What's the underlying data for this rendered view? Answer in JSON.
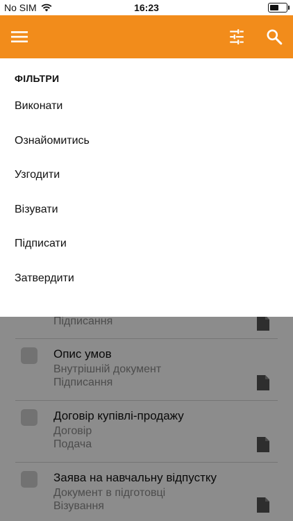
{
  "status_bar": {
    "carrier": "No SIM",
    "time": "16:23",
    "battery_level": 0.55
  },
  "app_bar": {
    "color": "#f28c1b",
    "icons": [
      "menu-icon",
      "tune-icon",
      "search-icon"
    ]
  },
  "filters": {
    "heading": "ФІЛЬТРИ",
    "items": [
      {
        "label": "Виконати"
      },
      {
        "label": "Ознайомитись"
      },
      {
        "label": "Узгодити"
      },
      {
        "label": "Візувати"
      },
      {
        "label": "Підписати"
      },
      {
        "label": "Затвердити"
      }
    ]
  },
  "documents": [
    {
      "title": "",
      "type": "",
      "status": "Підписання"
    },
    {
      "title": "Опис умов",
      "type": "Внутрішній документ",
      "status": "Підписання"
    },
    {
      "title": "Договір купівлі-продажу",
      "type": "Договір",
      "status": "Подача"
    },
    {
      "title": "Заява на навчальну відпустку",
      "type": "Документ в підготовці",
      "status": "Візування"
    }
  ]
}
